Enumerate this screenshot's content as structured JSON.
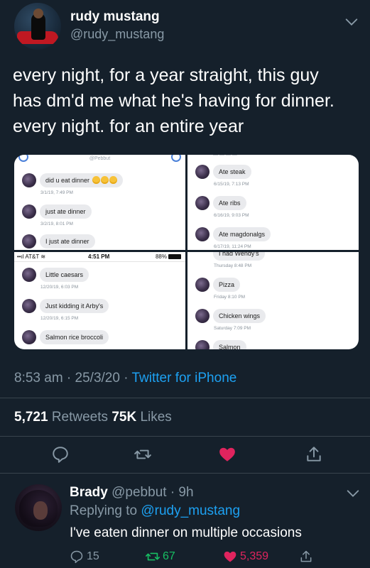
{
  "tweet": {
    "author_name": "rudy mustang",
    "author_handle": "@rudy_mustang",
    "text_lines": [
      "every night, for a year straight, this guy",
      "has dm'd me what he's having for dinner.",
      "every night. for an entire year"
    ],
    "timestamp": "8:53 am · 25/3/20 · ",
    "source": "Twitter for iPhone",
    "retweets_count": "5,721",
    "retweets_label": " Retweets ",
    "likes_count": "75K",
    "likes_label": " Likes"
  },
  "screenshots": {
    "top_left": {
      "header": "@Pebbut",
      "messages": [
        {
          "text": "did u eat dinner",
          "time": "3/1/19, 7:49 PM"
        },
        {
          "text": "just ate dinner",
          "time": "3/2/19, 8:01 PM"
        },
        {
          "text": "I just ate dinner",
          "time": ""
        }
      ]
    },
    "bottom_left": {
      "carrier": "AT&T",
      "clock": "4:51 PM",
      "battery": "88%",
      "messages": [
        {
          "text": "Little caesars",
          "time": "12/20/19, 6:03 PM"
        },
        {
          "text": "Just kidding it Arby's",
          "time": "12/20/19, 6:15 PM"
        },
        {
          "text": "Salmon rice broccoli",
          "time": ""
        }
      ]
    },
    "top_right": {
      "messages": [
        {
          "text": "Ate steak",
          "time": "6/15/19, 7:13 PM"
        },
        {
          "text": "Ate ribs",
          "time": "6/16/19, 9:03 PM"
        },
        {
          "text": "Ate magdonalgs",
          "time": "6/17/19, 11:24 PM"
        }
      ]
    },
    "bottom_right": {
      "messages": [
        {
          "text": "I had Wendy's",
          "time": "Thursday 8:48 PM"
        },
        {
          "text": "Pizza",
          "time": "Friday 8:10 PM"
        },
        {
          "text": "Chicken wings",
          "time": "Saturday 7:09 PM"
        },
        {
          "text": "Salmon",
          "time": ""
        }
      ]
    }
  },
  "reply": {
    "author_name": "Brady",
    "author_meta": " @pebbut · 9h",
    "replying_label": "Replying to ",
    "replying_handle": "@rudy_mustang",
    "text": "I've eaten dinner on multiple occasions",
    "reply_count": "15",
    "retweet_count": "67",
    "like_count": "5,359"
  },
  "colors": {
    "background": "#15202b",
    "secondary_text": "#8899a6",
    "accent_blue": "#1da1f2",
    "like_red": "#e0245e",
    "retweet_green": "#17bf63"
  },
  "icons": [
    "chevron-down-icon",
    "reply-icon",
    "retweet-icon",
    "heart-icon",
    "share-icon"
  ]
}
